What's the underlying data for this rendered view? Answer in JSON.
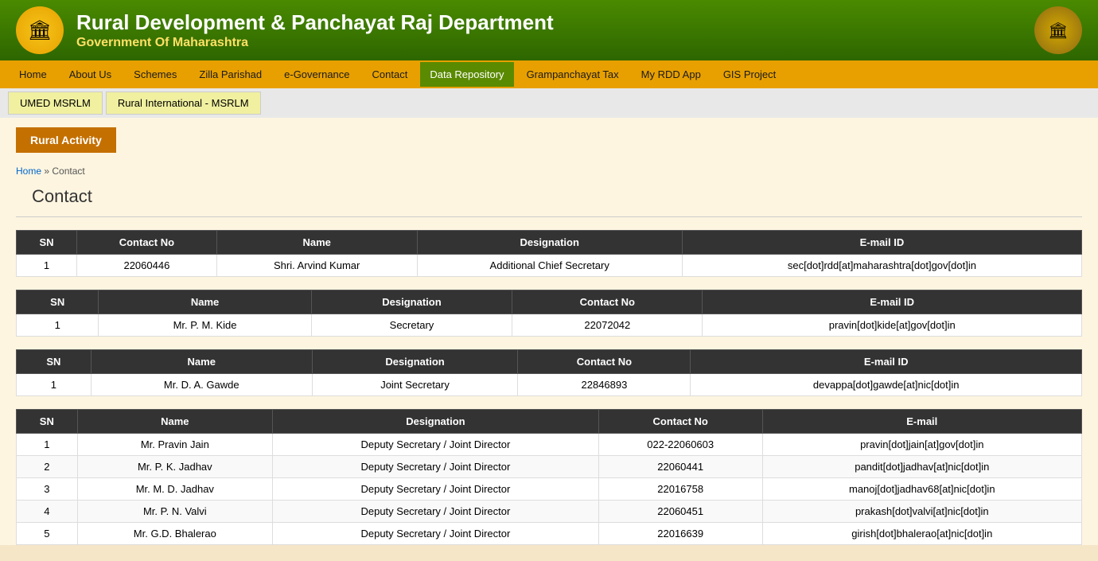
{
  "header": {
    "logo_left_icon": "🏛",
    "logo_right_icon": "🏛",
    "title": "Rural Development & Panchayat Raj Department",
    "subtitle": "Government Of Maharashtra"
  },
  "nav": {
    "items": [
      {
        "label": "Home",
        "active": false
      },
      {
        "label": "About Us",
        "active": false
      },
      {
        "label": "Schemes",
        "active": false
      },
      {
        "label": "Zilla Parishad",
        "active": false
      },
      {
        "label": "e-Governance",
        "active": false
      },
      {
        "label": "Contact",
        "active": false
      },
      {
        "label": "Data Repository",
        "active": true
      },
      {
        "label": "Grampanchayat Tax",
        "active": false
      },
      {
        "label": "My RDD App",
        "active": false
      },
      {
        "label": "GIS Project",
        "active": false
      }
    ],
    "sub_items": [
      {
        "label": "UMED MSRLM"
      },
      {
        "label": "Rural International - MSRLM"
      }
    ]
  },
  "rural_activity_label": "Rural Activity",
  "breadcrumb": {
    "home": "Home",
    "separator": "»",
    "current": "Contact"
  },
  "page_title": "Contact",
  "table1": {
    "headers": [
      "SN",
      "Contact No",
      "Name",
      "Designation",
      "E-mail ID"
    ],
    "rows": [
      [
        "1",
        "22060446",
        "Shri. Arvind Kumar",
        "Additional Chief Secretary",
        "sec[dot]rdd[at]maharashtra[dot]gov[dot]in"
      ]
    ]
  },
  "table2": {
    "headers": [
      "SN",
      "Name",
      "Designation",
      "Contact No",
      "E-mail ID"
    ],
    "rows": [
      [
        "1",
        "Mr. P. M. Kide",
        "Secretary",
        "22072042",
        "pravin[dot]kide[at]gov[dot]in"
      ]
    ]
  },
  "table3": {
    "headers": [
      "SN",
      "Name",
      "Designation",
      "Contact No",
      "E-mail ID"
    ],
    "rows": [
      [
        "1",
        "Mr. D. A. Gawde",
        "Joint Secretary",
        "22846893",
        "devappa[dot]gawde[at]nic[dot]in"
      ]
    ]
  },
  "table4": {
    "headers": [
      "SN",
      "Name",
      "Designation",
      "Contact No",
      "E-mail"
    ],
    "rows": [
      [
        "1",
        "Mr. Pravin Jain",
        "Deputy Secretary / Joint Director",
        "022-22060603",
        "pravin[dot]jain[at]gov[dot]in"
      ],
      [
        "2",
        "Mr. P. K. Jadhav",
        "Deputy Secretary / Joint Director",
        "22060441",
        "pandit[dot]jadhav[at]nic[dot]in"
      ],
      [
        "3",
        "Mr. M. D. Jadhav",
        "Deputy Secretary / Joint Director",
        "22016758",
        "manoj[dot]jadhav68[at]nic[dot]in"
      ],
      [
        "4",
        "Mr. P. N. Valvi",
        "Deputy Secretary / Joint Director",
        "22060451",
        "prakash[dot]valvi[at]nic[dot]in"
      ],
      [
        "5",
        "Mr. G.D. Bhalerao",
        "Deputy Secretary / Joint Director",
        "22016639",
        "girish[dot]bhalerao[at]nic[dot]in"
      ]
    ]
  }
}
